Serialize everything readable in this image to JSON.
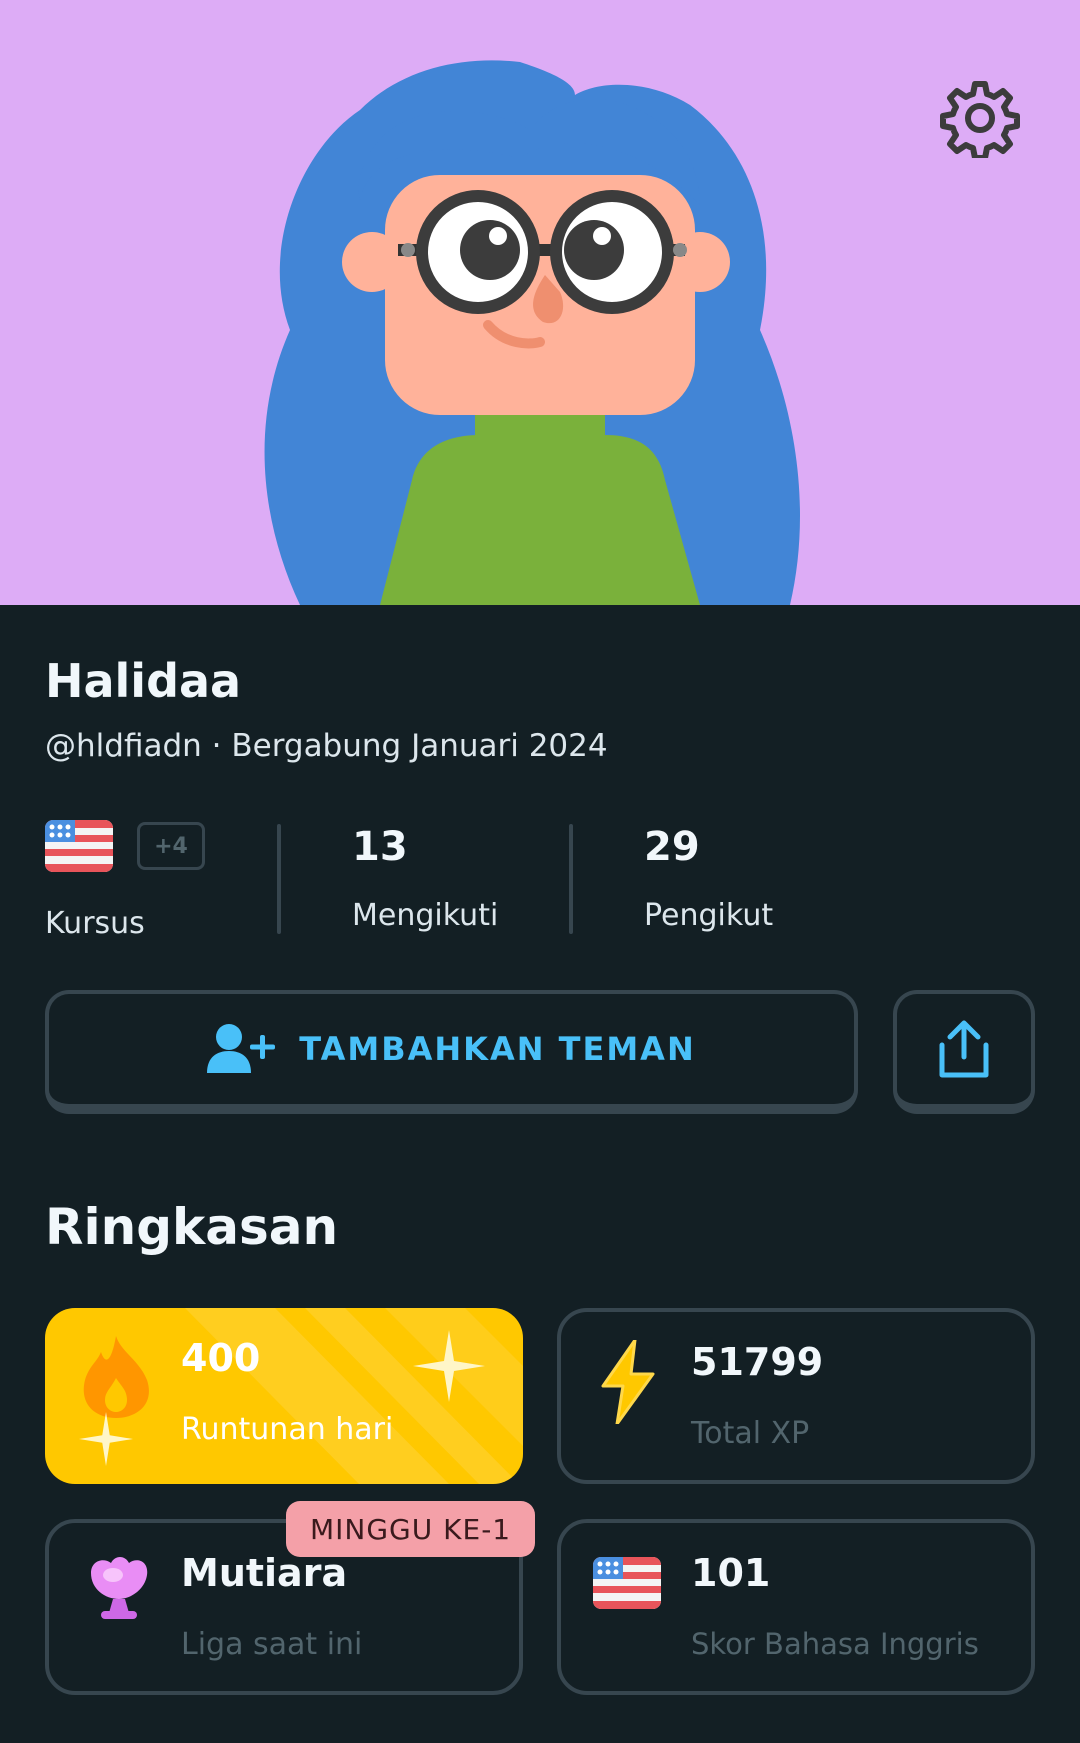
{
  "colors": {
    "hero_bg": "#ddacf6",
    "page_bg": "#131f24",
    "accent_blue": "#49c0f8",
    "streak_yellow": "#ffc800",
    "border": "#37464f",
    "muted": "#52656d",
    "badge_pink": "#f4a0a8"
  },
  "header": {
    "settings_icon": "gear-icon"
  },
  "profile": {
    "name": "Halidaa",
    "handle_joined": "@hldfiadn · Bergabung Januari 2024"
  },
  "stats": {
    "courses": {
      "extra": "+4",
      "label": "Kursus",
      "flag_icon": "us-flag-icon"
    },
    "following": {
      "value": "13",
      "label": "Mengikuti"
    },
    "followers": {
      "value": "29",
      "label": "Pengikut"
    }
  },
  "actions": {
    "add_friend_label": "TAMBAHKAN TEMAN",
    "add_friend_icon": "add-person-icon",
    "share_icon": "share-icon"
  },
  "summary": {
    "title": "Ringkasan",
    "cards": [
      {
        "value": "400",
        "label": "Runtunan hari",
        "icon": "fire-icon"
      },
      {
        "value": "51799",
        "label": "Total XP",
        "icon": "lightning-icon"
      },
      {
        "value": "Mutiara",
        "label": "Liga saat ini",
        "icon": "pearl-icon",
        "badge": "MINGGU KE-1"
      },
      {
        "value": "101",
        "label": "Skor Bahasa Inggris",
        "icon": "us-flag-icon"
      }
    ]
  }
}
